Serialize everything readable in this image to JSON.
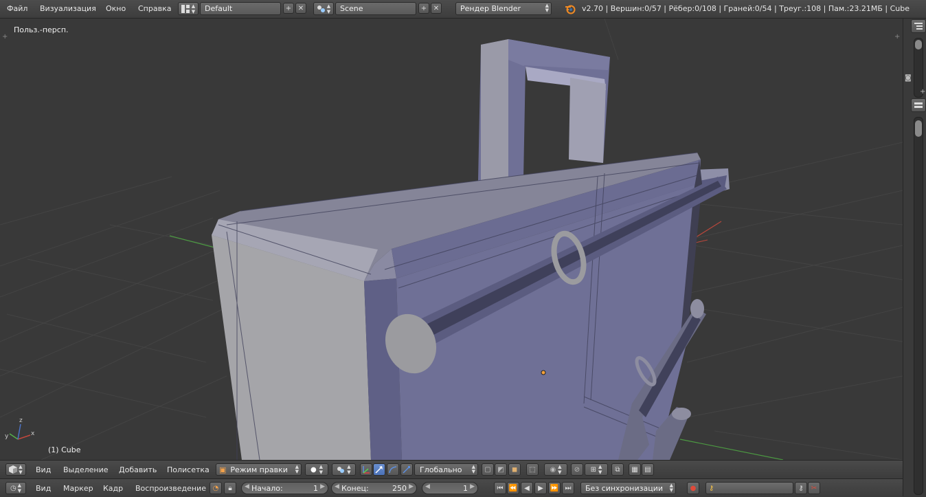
{
  "topbar": {
    "menus": [
      "Файл",
      "Визуализация",
      "Окно",
      "Справка"
    ],
    "layout": "Default",
    "scene": "Scene",
    "engine": "Рендер Blender",
    "stats": "v2.70 | Вершин:0/57 | Рёбер:0/108 | Граней:0/54 | Треуг.:108 | Пам.:23.21МБ | Cube"
  },
  "viewport": {
    "view_label": "Польз.-персп.",
    "object_label": "(1) Cube",
    "axis_x": "x",
    "axis_y": "y",
    "axis_z": "z"
  },
  "header3d": {
    "menus": [
      "Вид",
      "Выделение",
      "Добавить",
      "Полисетка"
    ],
    "mode": "Режим правки",
    "orientation": "Глобально"
  },
  "timeline": {
    "menus": [
      "Вид",
      "Маркер",
      "Кадр",
      "Воспроизведение"
    ],
    "start_label": "Начало:",
    "start_value": "1",
    "end_label": "Конец:",
    "end_value": "250",
    "current_frame": "1",
    "sync": "Без синхронизации"
  },
  "colors": {
    "background": "#393939",
    "mesh_face": "#6f7096",
    "mesh_light": "#9d9db4",
    "axis_x": "#c7483c",
    "axis_y": "#55b24a",
    "active_button": "#5680c2"
  }
}
